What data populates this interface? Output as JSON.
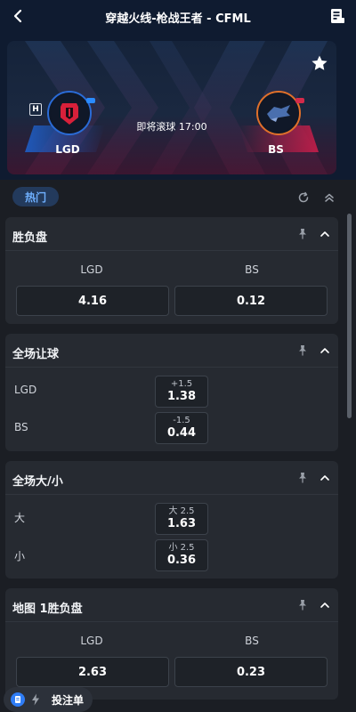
{
  "header": {
    "title": "穿越火线-枪战王者 - CFML",
    "back_icon": "chevron-left-icon",
    "doc_icon": "scoreboard-icon"
  },
  "match": {
    "home": {
      "name": "LGD",
      "badge": "H"
    },
    "away": {
      "name": "BS"
    },
    "kickoff": "即将滚球 17:00",
    "favorite_icon": "star-icon"
  },
  "filter": {
    "active_tab": "热门",
    "refresh_icon": "refresh-icon",
    "collapse_icon": "double-chevron-up-icon"
  },
  "markets": [
    {
      "title": "胜负盘",
      "columns": [
        "LGD",
        "BS"
      ],
      "odds": [
        "4.16",
        "0.12"
      ]
    },
    {
      "title": "全场让球",
      "rows": [
        {
          "label": "LGD",
          "line": "+1.5",
          "odds": "1.38"
        },
        {
          "label": "BS",
          "line": "-1.5",
          "odds": "0.44"
        }
      ]
    },
    {
      "title": "全场大/小",
      "rows": [
        {
          "label": "大",
          "line": "大 2.5",
          "odds": "1.63"
        },
        {
          "label": "小",
          "line": "小 2.5",
          "odds": "0.36"
        }
      ]
    },
    {
      "title": "地图 1胜负盘",
      "columns": [
        "LGD",
        "BS"
      ],
      "odds": [
        "2.63",
        "0.23"
      ]
    }
  ],
  "betslip": {
    "label": "投注单"
  },
  "colors": {
    "accent": "#2f7df6",
    "header_bg": "#0f1b30",
    "page_bg": "#1b1e24",
    "card_bg": "#262a31"
  }
}
